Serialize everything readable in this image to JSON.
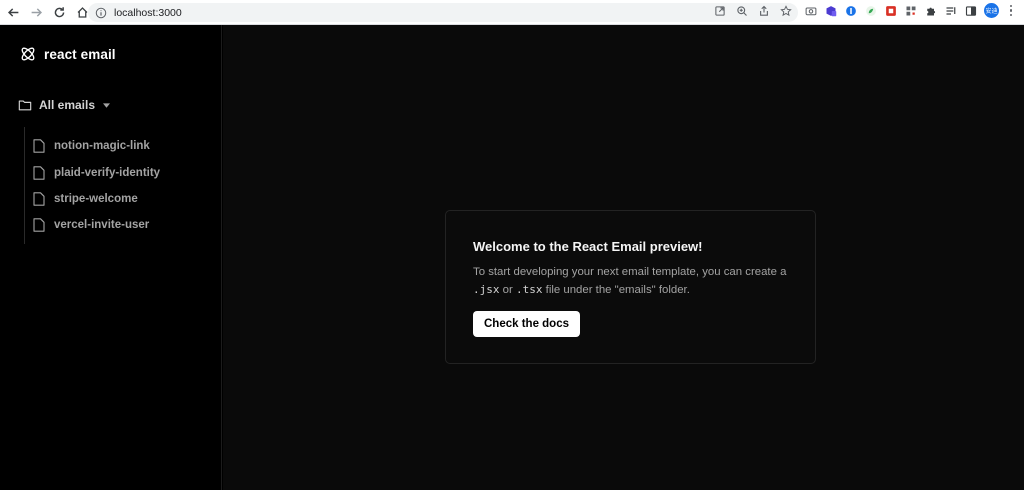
{
  "browser": {
    "url": "localhost:3000",
    "profile_initials": "安迪"
  },
  "sidebar": {
    "brand": "react email",
    "folder_label": "All emails",
    "items": [
      {
        "label": "notion-magic-link"
      },
      {
        "label": "plaid-verify-identity"
      },
      {
        "label": "stripe-welcome"
      },
      {
        "label": "vercel-invite-user"
      }
    ]
  },
  "card": {
    "title": "Welcome to the React Email preview!",
    "body_start": "To start developing your next email template, you can create a",
    "code_jsx": ".jsx",
    "or": "or",
    "code_tsx": ".tsx",
    "body_end": "file under the \"emails\" folder.",
    "button_label": "Check the docs"
  },
  "colors": {
    "sidebar_bg": "#000000",
    "main_bg": "#0a0a0a",
    "text_muted": "#a3a3a3",
    "button_bg": "#ffffff"
  }
}
